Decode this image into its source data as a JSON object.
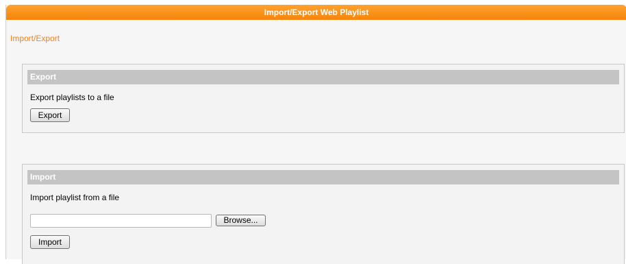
{
  "window": {
    "title": "Import/Export Web Playlist"
  },
  "breadcrumb": {
    "link_label": "Import/Export"
  },
  "export_section": {
    "header": "Export",
    "description": "Export playlists to a file",
    "button_label": "Export"
  },
  "import_section": {
    "header": "Import",
    "description": "Import playlist from a file",
    "file_value": "",
    "browse_label": "Browse...",
    "button_label": "Import"
  },
  "colors": {
    "title_bar": "#f5850d",
    "link": "#f0821a",
    "section_header": "#c4c4c4"
  }
}
